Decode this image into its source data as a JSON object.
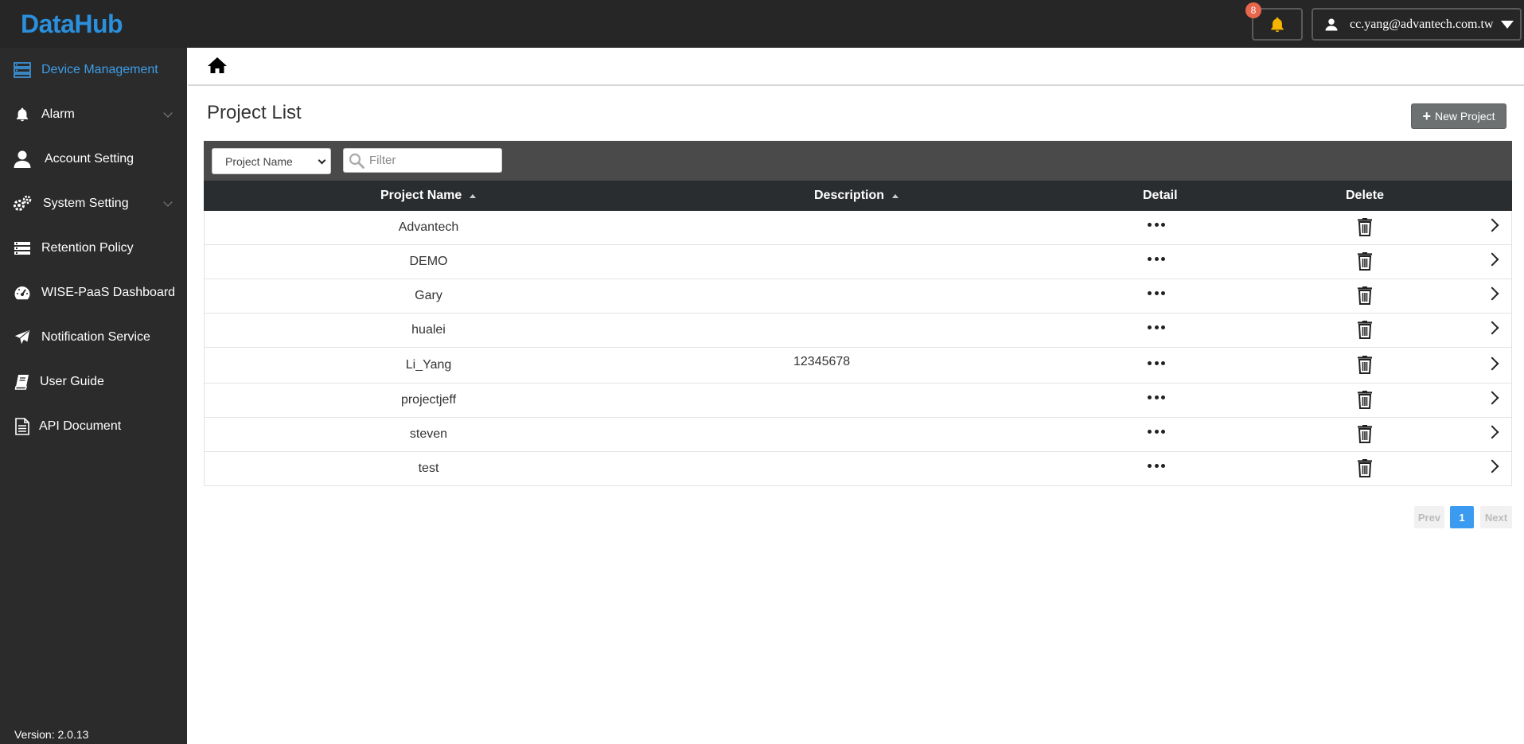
{
  "app": {
    "logo": "DataHub"
  },
  "header": {
    "notification_count": "8",
    "user_email": "cc.yang@advantech.com.tw"
  },
  "sidebar": {
    "items": [
      {
        "label": "Device Management",
        "icon": "server-icon",
        "active": true
      },
      {
        "label": "Alarm",
        "icon": "bell-icon",
        "expandable": true
      },
      {
        "label": "Account Setting",
        "icon": "user-icon"
      },
      {
        "label": "System Setting",
        "icon": "gears-icon",
        "expandable": true
      },
      {
        "label": "Retention Policy",
        "icon": "list-icon"
      },
      {
        "label": "WISE-PaaS Dashboard",
        "icon": "dashboard-icon"
      },
      {
        "label": "Notification Service",
        "icon": "paper-plane-icon"
      },
      {
        "label": "User Guide",
        "icon": "book-icon"
      },
      {
        "label": "API Document",
        "icon": "document-icon"
      }
    ],
    "version": "Version: 2.0.13"
  },
  "main": {
    "title": "Project List",
    "new_button": "New Project",
    "filter": {
      "field_selected": "Project Name",
      "placeholder": "Filter"
    },
    "table": {
      "columns": [
        "Project Name",
        "Description",
        "Detail",
        "Delete"
      ],
      "rows": [
        {
          "name": "Advantech",
          "description": ""
        },
        {
          "name": "DEMO",
          "description": ""
        },
        {
          "name": "Gary",
          "description": ""
        },
        {
          "name": "hualei",
          "description": ""
        },
        {
          "name": "Li_Yang",
          "description": "12345678"
        },
        {
          "name": "projectjeff",
          "description": ""
        },
        {
          "name": "steven",
          "description": ""
        },
        {
          "name": "test",
          "description": ""
        }
      ]
    },
    "pagination": {
      "prev": "Prev",
      "current": "1",
      "next": "Next"
    }
  },
  "colors": {
    "accent": "#3d9ee8",
    "topbar": "#262626",
    "sidebar": "#2b2b2b",
    "table_header": "#2a2d30",
    "filter_bar": "#4a4a4a",
    "badge": "#e8664c"
  }
}
